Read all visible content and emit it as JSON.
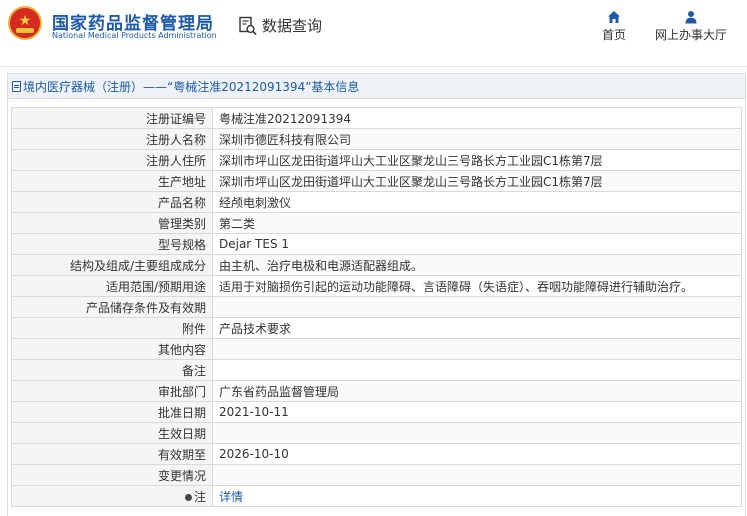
{
  "header": {
    "org_name_cn": "国家药品监督管理局",
    "org_name_en": "National Medical Products Administration",
    "data_query": "数据查询",
    "nav": {
      "home": "首页",
      "online_service": "网上办事大厅"
    }
  },
  "panel": {
    "title": "境内医疗器械（注册）——“粤械注准20212091394”基本信息"
  },
  "fields": [
    {
      "label": "注册证编号",
      "value": "粤械注准20212091394"
    },
    {
      "label": "注册人名称",
      "value": "深圳市德匠科技有限公司"
    },
    {
      "label": "注册人住所",
      "value": "深圳市坪山区龙田街道坪山大工业区聚龙山三号路长方工业园C1栋第7层"
    },
    {
      "label": "生产地址",
      "value": "深圳市坪山区龙田街道坪山大工业区聚龙山三号路长方工业园C1栋第7层"
    },
    {
      "label": "产品名称",
      "value": "经颅电刺激仪"
    },
    {
      "label": "管理类别",
      "value": "第二类"
    },
    {
      "label": "型号规格",
      "value": "Dejar TES 1"
    },
    {
      "label": "结构及组成/主要组成成分",
      "value": "由主机、治疗电极和电源适配器组成。"
    },
    {
      "label": "适用范围/预期用途",
      "value": "适用于对脑损伤引起的运动功能障碍、言语障碍（失语症）、吞咽功能障碍进行辅助治疗。"
    },
    {
      "label": "产品储存条件及有效期",
      "value": ""
    },
    {
      "label": "附件",
      "value": "产品技术要求"
    },
    {
      "label": "其他内容",
      "value": ""
    },
    {
      "label": "备注",
      "value": ""
    },
    {
      "label": "审批部门",
      "value": "广东省药品监督管理局"
    },
    {
      "label": "批准日期",
      "value": "2021-10-11"
    },
    {
      "label": "生效日期",
      "value": ""
    },
    {
      "label": "有效期至",
      "value": "2026-10-10"
    },
    {
      "label": "变更情况",
      "value": ""
    }
  ],
  "note_row": {
    "label": "注",
    "link": "详情"
  }
}
